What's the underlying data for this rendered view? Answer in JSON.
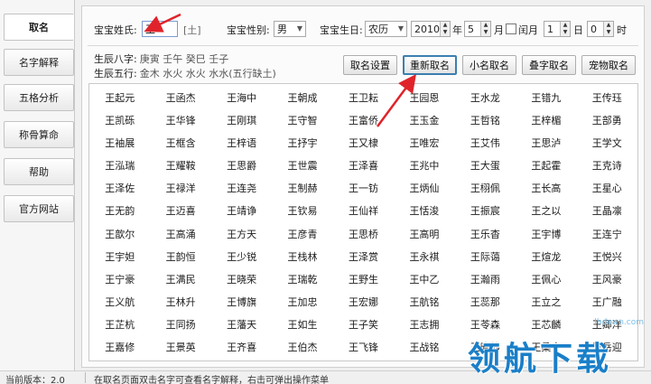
{
  "sidebar": {
    "items": [
      {
        "label": "取名",
        "active": true
      },
      {
        "label": "名字解释"
      },
      {
        "label": "五格分析"
      },
      {
        "label": "称骨算命"
      },
      {
        "label": "帮助"
      },
      {
        "label": "官方网站"
      }
    ]
  },
  "form": {
    "surname_label": "宝宝姓氏:",
    "surname_value": "王",
    "surname_hint": "[土]",
    "gender_label": "宝宝性别:",
    "gender_value": "男",
    "birthday_label": "宝宝生日:",
    "calendar_value": "农历",
    "year_value": "2010",
    "year_unit": "年",
    "month_value": "5",
    "month_unit": "月",
    "leap_label": "闰月",
    "day_value": "1",
    "day_unit": "日",
    "hour_value": "0",
    "hour_unit": "时"
  },
  "info": {
    "bazi_label": "生辰八字:",
    "bazi_value": "庚寅 壬午 癸巳 壬子",
    "wuxing_label": "生辰五行:",
    "wuxing_value": "金木 水火 水火 水水(五行缺土)"
  },
  "buttons": {
    "settings": "取名设置",
    "rename": "重新取名",
    "short_name": "小名取名",
    "double_name": "叠字取名",
    "pet_name": "宠物取名"
  },
  "names": [
    "王起元",
    "王函杰",
    "王海中",
    "王朝成",
    "王卫耘",
    "王园恩",
    "王水龙",
    "王错九",
    "王传珏",
    "王凯砾",
    "王华锋",
    "王刚琪",
    "王守智",
    "王富侨",
    "王玉金",
    "王哲铭",
    "王梓楣",
    "王部勇",
    "王袖展",
    "王框含",
    "王梓语",
    "王抒宇",
    "王又棣",
    "王唯宏",
    "王艾伟",
    "王思泸",
    "王学文",
    "王泓瑞",
    "王耀鞍",
    "王思爵",
    "王世震",
    "王泽喜",
    "王兆中",
    "王大蛋",
    "王起霍",
    "王克诗",
    "王泽佐",
    "王禄洋",
    "王连尧",
    "王制赫",
    "王一钫",
    "王炳仙",
    "王栩佩",
    "王长高",
    "王星心",
    "王无韵",
    "王迈喜",
    "王靖诤",
    "王钦易",
    "王仙祥",
    "王恬浚",
    "王振宸",
    "王之以",
    "王晶凛",
    "王歆尔",
    "王高涌",
    "王方天",
    "王彦青",
    "王思桥",
    "王高明",
    "王乐杳",
    "王宇博",
    "王连宁",
    "王宇妲",
    "王韵恒",
    "王少锐",
    "王栈林",
    "王泽赏",
    "王永祺",
    "王际蔼",
    "王煊龙",
    "王悦兴",
    "王宁豪",
    "王满民",
    "王晓荣",
    "王瑞乾",
    "王野生",
    "王中乙",
    "王瀚雨",
    "王佩心",
    "王风豪",
    "王义航",
    "王林升",
    "王博旗",
    "王加忠",
    "王宏娜",
    "王航铭",
    "王蕊那",
    "王立之",
    "王广融",
    "王芷杭",
    "王同扬",
    "王藩天",
    "王如生",
    "王子笑",
    "王志拥",
    "王苓森",
    "王芯麟",
    "王卿洋",
    "王嘉修",
    "王景英",
    "王齐喜",
    "王伯杰",
    "王飞锋",
    "王战铭",
    "王晓静",
    "王桑宁",
    "王岳迎"
  ],
  "status": {
    "version": "当前版本：2.0",
    "hint": "在取名页面双击名字可查看名字解释，右击可弹出操作菜单"
  },
  "watermark": {
    "url": "lhdown.com",
    "text": "领航下载"
  },
  "colors": {
    "accent": "#3c7fb1",
    "arrow": "#e0232a",
    "watermark": "#1a7fc8"
  }
}
